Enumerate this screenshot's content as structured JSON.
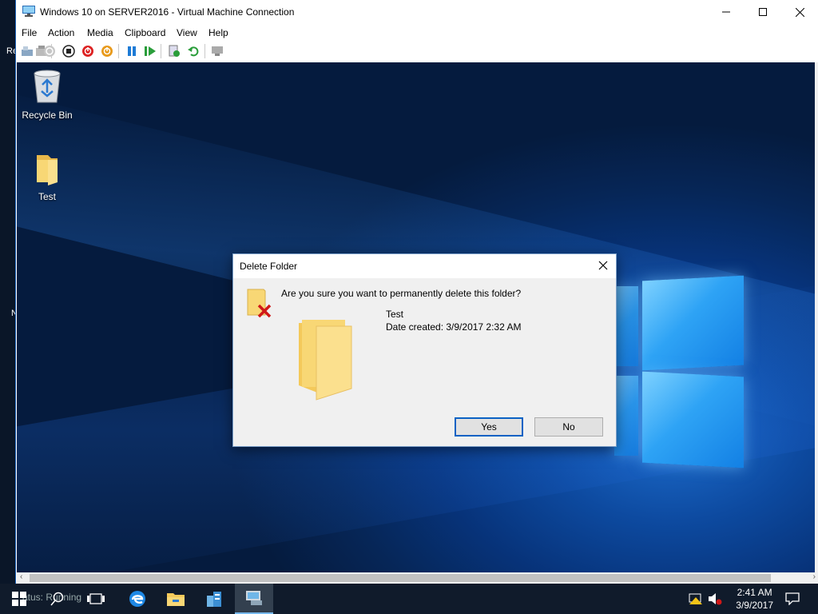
{
  "vm_window": {
    "title": "Windows 10 on SERVER2016 - Virtual Machine Connection",
    "menu": [
      "File",
      "Action",
      "Media",
      "Clipboard",
      "View",
      "Help"
    ],
    "toolbar_icons": [
      "ctrl-alt-del-icon",
      "type-clipboard-text-icon",
      "start-icon",
      "turn-off-icon",
      "shut-down-icon",
      "save-icon",
      "pause-icon",
      "resume-icon",
      "checkpoint-icon",
      "revert-icon",
      "enhanced-session-icon"
    ]
  },
  "host_left": {
    "fragments": [
      "Re",
      "N"
    ]
  },
  "desktop": {
    "icons": [
      {
        "label": "Recycle Bin",
        "icon": "recycle-bin-icon"
      },
      {
        "label": "Test",
        "icon": "folder-icon"
      }
    ]
  },
  "dialog": {
    "title": "Delete Folder",
    "message": "Are you sure you want to permanently delete this folder?",
    "item_name": "Test",
    "item_date": "Date created: 3/9/2017 2:32 AM",
    "yes_label": "Yes",
    "no_label": "No"
  },
  "taskbar": {
    "status_text": "atus: Running",
    "time": "2:41 AM",
    "date": "3/9/2017",
    "apps": [
      "start-icon",
      "search-icon",
      "task-view-icon",
      "edge-icon",
      "file-explorer-icon",
      "server-manager-icon",
      "hyper-v-manager-icon"
    ]
  }
}
